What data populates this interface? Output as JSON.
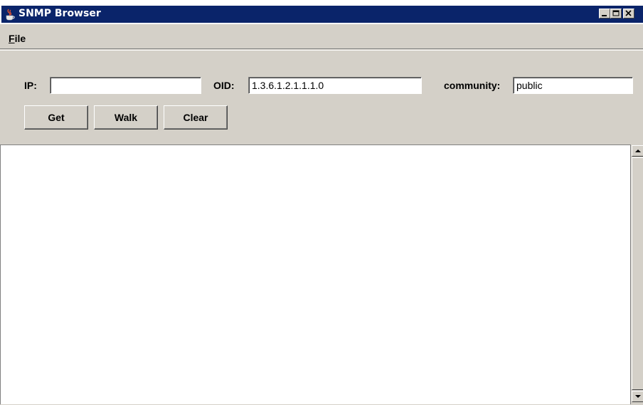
{
  "window": {
    "title": "SNMP Browser",
    "icon": "java-cup-icon",
    "controls": [
      "minimize-icon",
      "maximize-icon",
      "close-icon"
    ],
    "accent_color": "#0a246a"
  },
  "menu": {
    "file_mnemonic": "F",
    "file_rest": "ile"
  },
  "form": {
    "ip_label": "IP:",
    "ip_value": "",
    "oid_label": "OID:",
    "oid_value": "1.3.6.1.2.1.1.1.0",
    "community_label": "community:",
    "community_value": "public"
  },
  "buttons": {
    "get": "Get",
    "walk": "Walk",
    "clear": "Clear"
  },
  "output": {
    "text": ""
  }
}
